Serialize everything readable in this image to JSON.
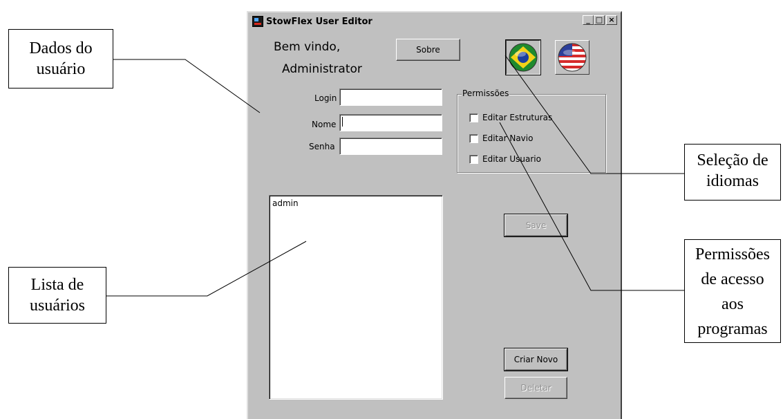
{
  "callouts": {
    "user_data": [
      "Dados do",
      "usuário"
    ],
    "user_list": [
      "Lista de",
      "usuários"
    ],
    "language": [
      "Seleção de",
      "idiomas"
    ],
    "permissions": [
      "Permissões",
      "de acesso",
      "aos",
      "programas"
    ]
  },
  "window": {
    "title": "StowFlex User Editor",
    "minimize": "_",
    "maximize": "□",
    "close": "×"
  },
  "welcome": {
    "line1": "Bem vindo,",
    "line2": "Administrator"
  },
  "buttons": {
    "about": "Sobre",
    "save": "Save",
    "create_new": "Criar Novo",
    "delete": "Deletar"
  },
  "languages": [
    {
      "name": "brazil-flag-icon",
      "selected": true
    },
    {
      "name": "usa-flag-icon",
      "selected": false
    }
  ],
  "form": {
    "login_label": "Login",
    "login_value": "",
    "name_label": "Nome",
    "name_value": "",
    "password_label": "Senha",
    "password_value": ""
  },
  "permissions": {
    "title": "Permissões",
    "items": [
      {
        "label": "Editar Estruturas",
        "checked": false
      },
      {
        "label": "Editar Navio",
        "checked": false
      },
      {
        "label": "Editar Usuario",
        "checked": false
      }
    ]
  },
  "users": [
    "admin"
  ]
}
